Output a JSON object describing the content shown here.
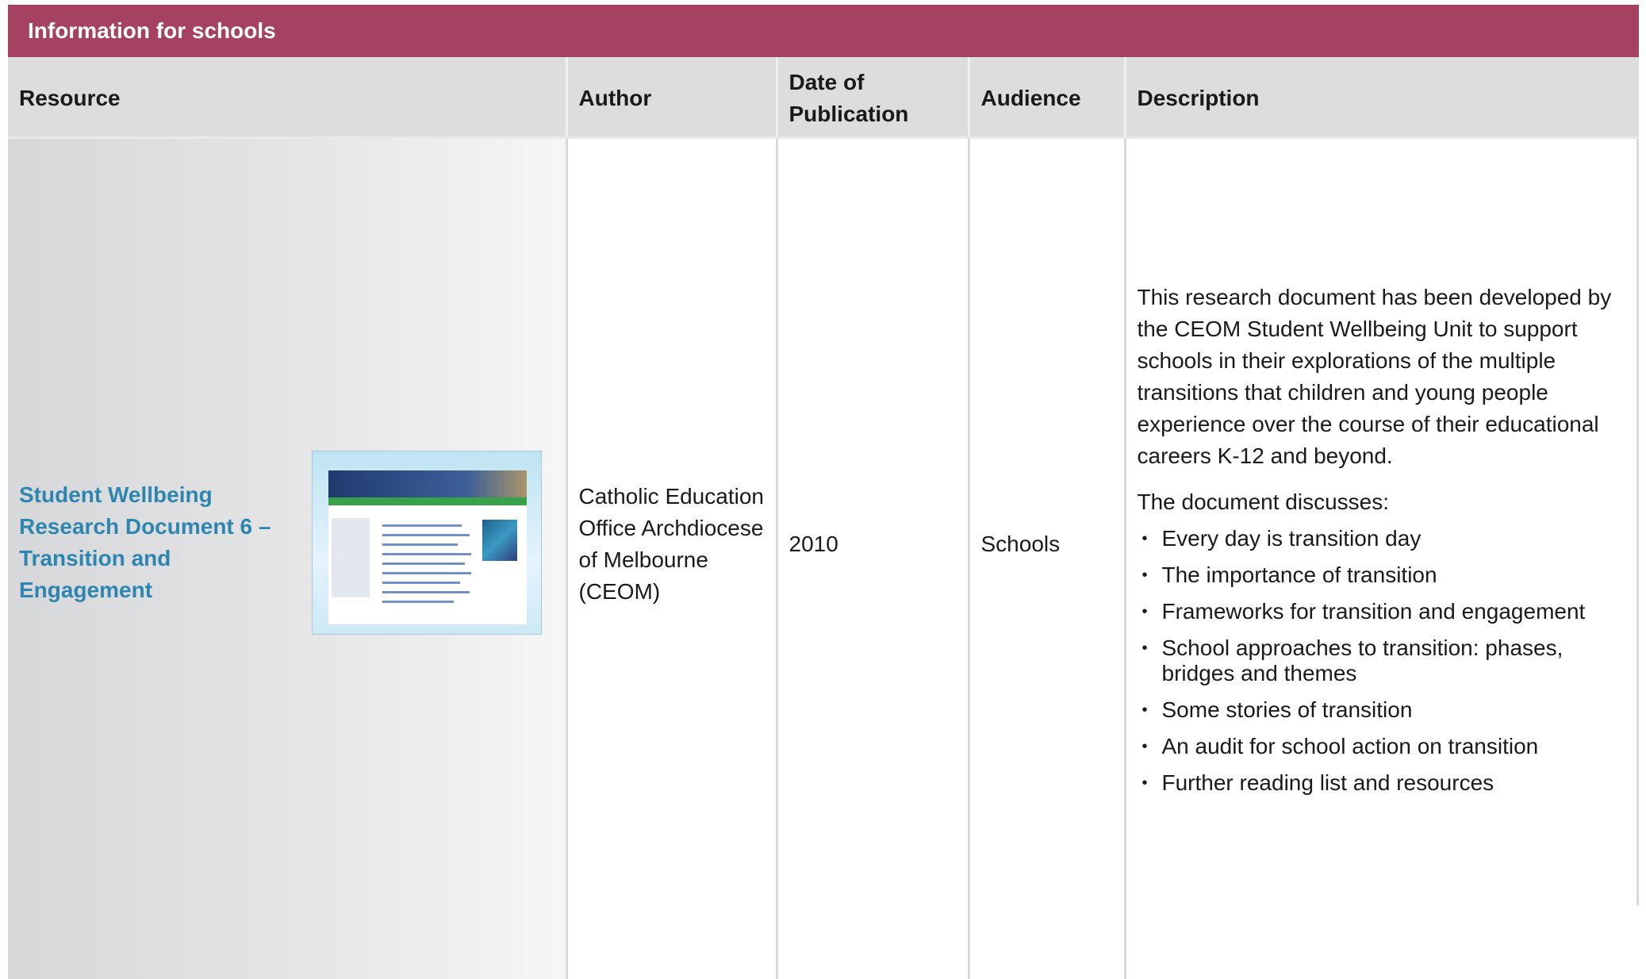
{
  "section_title": "Information for schools",
  "columns": {
    "resource": "Resource",
    "author": "Author",
    "date": "Date of Publication",
    "audience": "Audience",
    "description": "Description"
  },
  "rows": [
    {
      "resource_title": "Student Wellbeing Research Document 6 – Transition and Engagement",
      "thumbnail_icon": "document-cover-thumbnail",
      "author": "Catholic Education Office Archdiocese of Melbourne (CEOM)",
      "date": "2010",
      "audience": "Schools",
      "description_intro": "This research document has been developed by the CEOM Student Wellbeing Unit to support schools in their explorations of the multiple transitions that children and young people experience over the course of their educational careers K-12 and beyond.",
      "description_lead": "The document discusses:",
      "description_points": [
        "Every day is transition day",
        "The importance of transition",
        "Frameworks for transition and engagement",
        "School approaches to transition: phases, bridges and themes",
        "Some stories of transition",
        "An audit for school action on transition",
        "Further reading list and resources"
      ]
    }
  ],
  "colors": {
    "title_bar": "#a54262",
    "header_row": "#dcddde",
    "link": "#2e86b0"
  }
}
